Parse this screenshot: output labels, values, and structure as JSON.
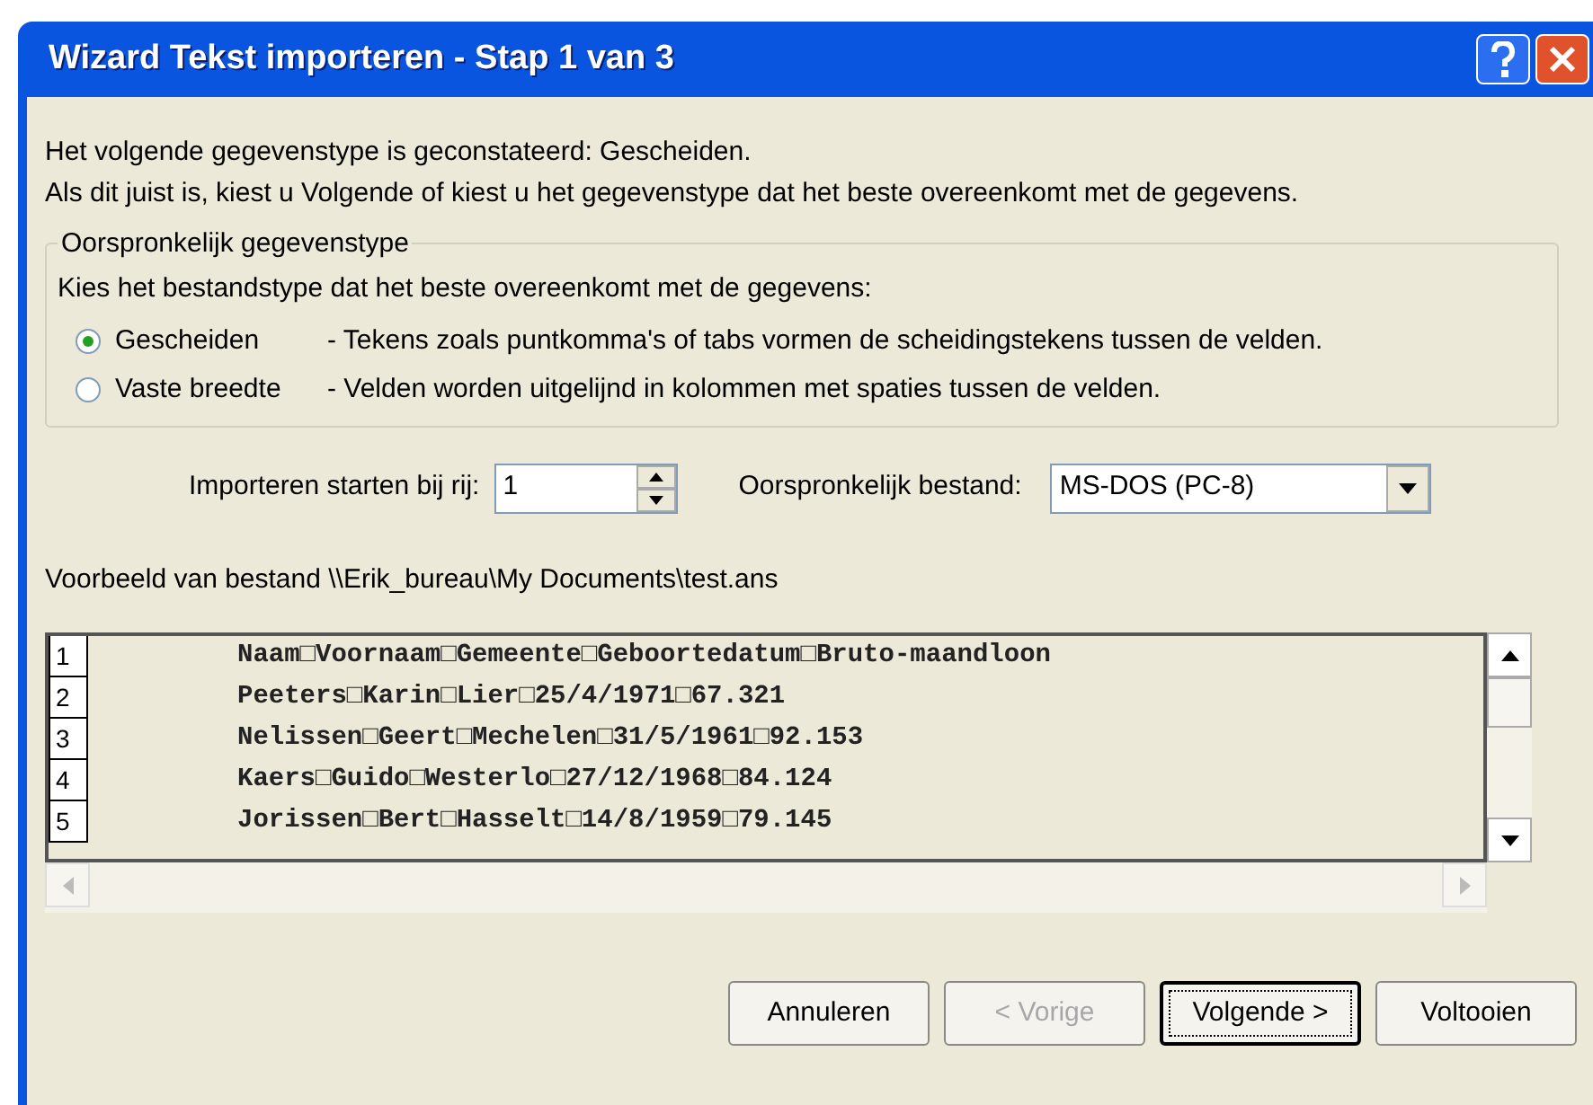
{
  "window": {
    "title": "Wizard Tekst importeren - Stap 1 van 3"
  },
  "intro": [
    "Het volgende gegevenstype is geconstateerd: Gescheiden.",
    "Als dit juist is, kiest u Volgende of kiest u het gegevenstype dat het beste overeenkomt met de gegevens."
  ],
  "group": {
    "title": "Oorspronkelijk gegevenstype",
    "prompt": "Kies het bestandstype dat het beste overeenkomt met de gegevens:",
    "options": [
      {
        "label": "Gescheiden",
        "description": "- Tekens zoals puntkomma's of tabs vormen de scheidingstekens tussen de velden.",
        "selected": true
      },
      {
        "label": "Vaste breedte",
        "description": "- Velden worden uitgelijnd in kolommen met spaties tussen de velden.",
        "selected": false
      }
    ]
  },
  "start_row": {
    "label": "Importeren starten bij rij:",
    "value": "1"
  },
  "origin": {
    "label": "Oorspronkelijk bestand:",
    "value": "MS-DOS (PC-8)"
  },
  "preview": {
    "label": "Voorbeeld van bestand \\\\Erik_bureau\\My Documents\\test.ans",
    "rows": [
      {
        "number": "1",
        "text": "Naam□Voornaam□Gemeente□Geboortedatum□Bruto-maandloon"
      },
      {
        "number": "2",
        "text": "Peeters□Karin□Lier□25/4/1971□67.321"
      },
      {
        "number": "3",
        "text": "Nelissen□Geert□Mechelen□31/5/1961□92.153"
      },
      {
        "number": "4",
        "text": "Kaers□Guido□Westerlo□27/12/1968□84.124"
      },
      {
        "number": "5",
        "text": "Jorissen□Bert□Hasselt□14/8/1959□79.145"
      }
    ]
  },
  "buttons": [
    {
      "label": "Annuleren",
      "disabled": false,
      "default": false
    },
    {
      "label": "< Vorige",
      "disabled": true,
      "default": false
    },
    {
      "label": "Volgende >",
      "disabled": false,
      "default": true
    },
    {
      "label": "Voltooien",
      "disabled": false,
      "default": false
    }
  ]
}
